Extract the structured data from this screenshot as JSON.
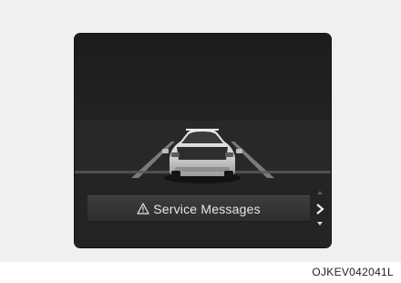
{
  "cluster": {
    "message": "Service Messages",
    "warning_icon": "warning-triangle-icon",
    "nav_up_icon": "scroll-up-icon",
    "nav_next_icon": "chevron-right-icon",
    "nav_down_icon": "scroll-down-icon"
  },
  "figure": {
    "code": "OJKEV042041L"
  },
  "colors": {
    "screen_bg": "#1e1e1e",
    "message_text": "#e6e6e6",
    "page_bg": "#f0f0f0"
  }
}
